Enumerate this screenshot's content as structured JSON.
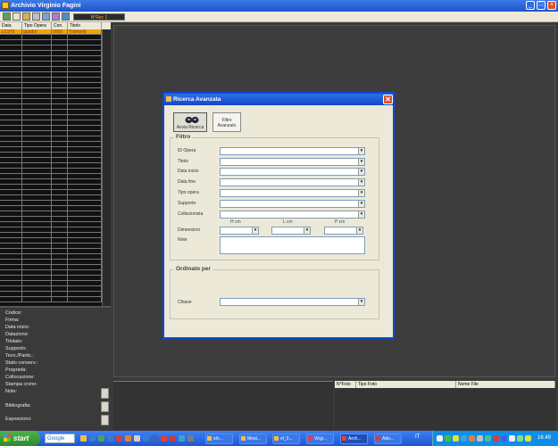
{
  "window": {
    "title": "Archivio Virginio Fagini"
  },
  "toolbar": {
    "icons": [
      "exit-icon",
      "new-record-icon",
      "open-icon",
      "print-icon",
      "edit-icon",
      "search-icon",
      "image-icon"
    ],
    "record_counter": "N°Rec 1"
  },
  "grid": {
    "columns": [
      "Data",
      "Tipo Opera",
      "Con.",
      "Titolo"
    ],
    "rows": [
      [
        "1/1979",
        "quadro",
        "0000",
        "Tramonti"
      ]
    ]
  },
  "details": {
    "labels": [
      "Codice:",
      "Firma:",
      "Data inizio:",
      "Datazione:",
      "Titolato:",
      "Supporto:",
      "Tecn./Partic.:",
      "Stato conserv.:",
      "Proprietà:",
      "Collocazione:",
      "Stampa crono:",
      "Note:",
      "Bibliografia:",
      "Esposizioni:"
    ]
  },
  "photos": {
    "columns": [
      "N°Foto",
      "Tipo Foto",
      "Nome File"
    ]
  },
  "dialog": {
    "title": "Ricerca Avanzata",
    "close": "✕",
    "run_search_label": "Avvia Ricerca",
    "advanced_filter_label_1": "Filtro",
    "advanced_filter_label_2": "Avanzato",
    "filter_group": "Filtro",
    "fields": [
      "ID Opera",
      "Titolo",
      "Data inizio",
      "Data fine",
      "Tipo opera",
      "Supporto",
      "Collezionista"
    ],
    "dimension_headers": [
      "H cm",
      "L cm",
      "P cm"
    ],
    "dimensions_label": "Dimensioni",
    "notes_label": "Note",
    "order_group": "Ordinato per",
    "key_label": "Chiave"
  },
  "taskbar": {
    "start_label": "start",
    "search_text": "Google",
    "tasks": [
      "sfo...",
      "Most...",
      "vf_0...",
      "Virgi...",
      "Arch...",
      "Ado..."
    ],
    "language": "IT",
    "clock": "16.49"
  }
}
